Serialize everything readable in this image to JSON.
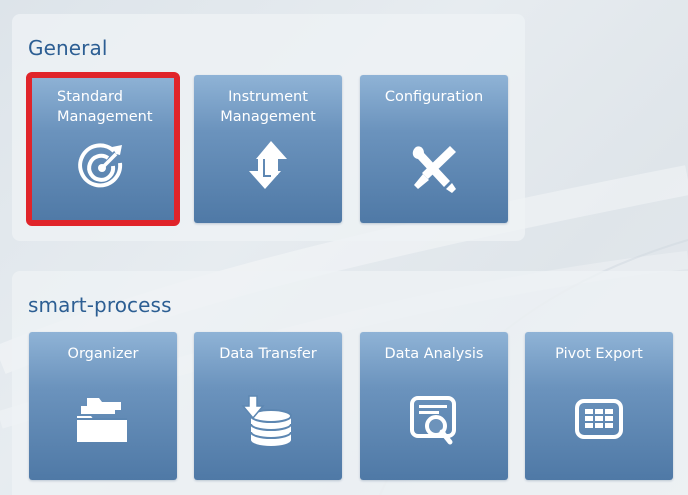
{
  "sections": [
    {
      "title": "General",
      "tiles": [
        {
          "label_line1": "Standard",
          "label_line2": "Management",
          "icon": "target-icon",
          "selected": true
        },
        {
          "label_line1": "Instrument",
          "label_line2": "Management",
          "icon": "up-down-arrows-icon",
          "selected": false
        },
        {
          "label_line1": "Configuration",
          "label_line2": "",
          "icon": "tools-icon",
          "selected": false
        }
      ]
    },
    {
      "title": "smart-process",
      "tiles": [
        {
          "label_line1": "Organizer",
          "label_line2": "",
          "icon": "folders-icon",
          "selected": false
        },
        {
          "label_line1": "Data Transfer",
          "label_line2": "",
          "icon": "database-download-icon",
          "selected": false
        },
        {
          "label_line1": "Data Analysis",
          "label_line2": "",
          "icon": "report-search-icon",
          "selected": false
        },
        {
          "label_line1": "Pivot Export",
          "label_line2": "",
          "icon": "table-icon",
          "selected": false
        }
      ]
    }
  ],
  "colors": {
    "section_title": "#2c5e93",
    "tile_top": "#8fb3d6",
    "tile_bottom": "#4f79a6",
    "selection_border": "#e0242a"
  }
}
